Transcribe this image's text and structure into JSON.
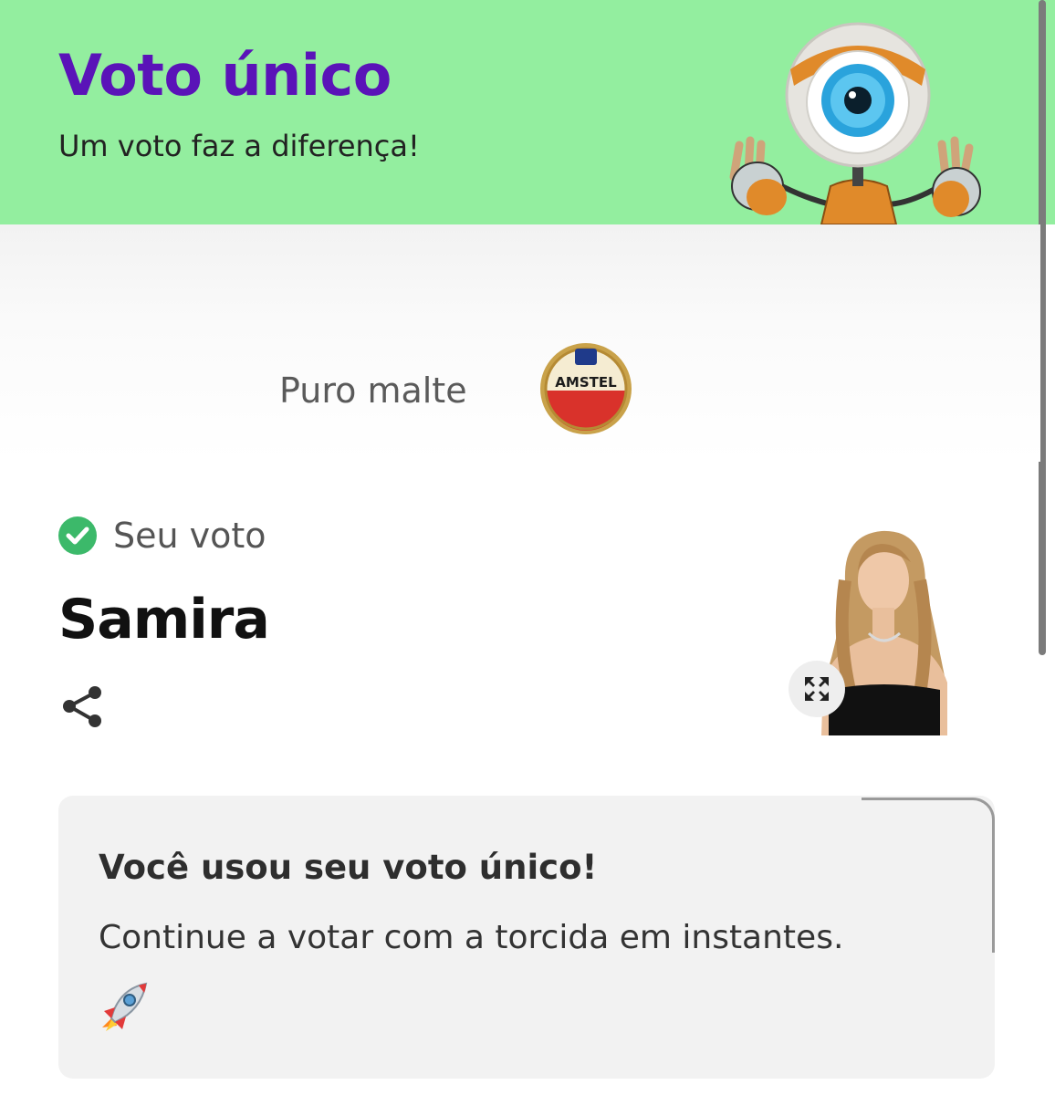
{
  "header": {
    "title": "Voto único",
    "subtitle": "Um voto faz a diferença!",
    "background": "#93ee9f",
    "title_color": "#5a13b8",
    "mascot_icon": "eye-mascot-icon"
  },
  "sponsor": {
    "text": "Puro malte",
    "logo_icon": "amstel-logo-icon",
    "logo_text": "AMSTEL"
  },
  "vote": {
    "label": "Seu voto",
    "check_icon": "check-circle-icon",
    "check_color": "#3cb96a",
    "candidate": "Samira",
    "share_icon": "share-icon",
    "expand_icon": "expand-icon"
  },
  "card": {
    "title": "Você usou seu voto único!",
    "text": "Continue a votar com a torcida em instantes.",
    "emoji": "🚀"
  }
}
